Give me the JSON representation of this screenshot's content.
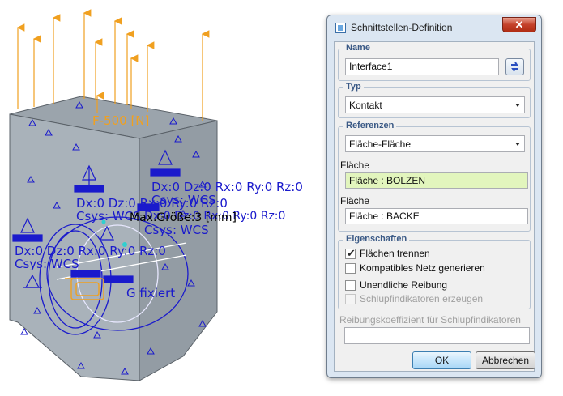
{
  "viewport": {
    "load_label": "F-500 [N]",
    "constraint_labels": [
      "Dx:0 Dz:0 Rx:0 Ry:0 Rz:0",
      "Csys: WCS",
      "Dx:0 Dz:0 Rx:0 Ry:0 Rz:0",
      "Csys: WCS",
      "Dx:0 Dz:0 Rx:0 Ry:0 Rz:0",
      "Csys: WCS",
      "Max.Größe:3 [mm]",
      "Dx:0 Dz:0 Rx:0 Ry:0 Rz:0",
      "Csys: WCS",
      "G fixiert"
    ]
  },
  "dialog": {
    "title": "Schnittstellen-Definition",
    "close_glyph": "✕",
    "name_group": {
      "title": "Name",
      "value": "Interface1"
    },
    "typ_group": {
      "title": "Typ",
      "selected": "Kontakt"
    },
    "referenzen_group": {
      "title": "Referenzen",
      "selected": "Fläche-Fläche",
      "ref1_label": "Fläche",
      "ref1_value": "Fläche : BOLZEN",
      "ref2_label": "Fläche",
      "ref2_value": "Fläche : BACKE"
    },
    "eigenschaften_group": {
      "title": "Eigenschaften",
      "options": [
        {
          "label": "Flächen trennen",
          "checked": true,
          "enabled": true
        },
        {
          "label": "Kompatibles Netz generieren",
          "checked": false,
          "enabled": true
        },
        {
          "label": "Unendliche Reibung",
          "checked": false,
          "enabled": true
        },
        {
          "label": "Schlupfindikatoren erzeugen",
          "checked": false,
          "enabled": false
        }
      ]
    },
    "friction_label": "Reibungskoeffizient für Schlupfindikatoren",
    "friction_value": "",
    "ok_label": "OK",
    "cancel_label": "Abbrechen"
  },
  "colors": {
    "constraint_blue": "#1a1acc",
    "load_orange": "#f0a020",
    "part_gray": "#a7b0b8",
    "selected_ref": "#e2f5bd"
  }
}
